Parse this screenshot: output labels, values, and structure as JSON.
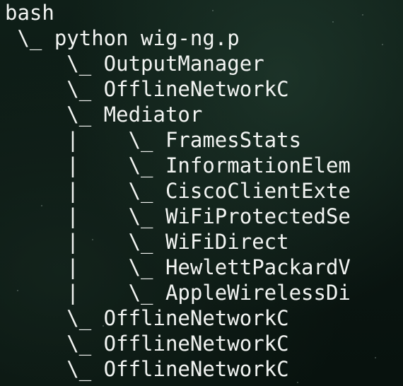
{
  "terminal": {
    "lines": [
      "bash",
      " \\_ python wig-ng.p",
      "     \\_ OutputManager",
      "     \\_ OfflineNetworkC",
      "     \\_ Mediator",
      "     |    \\_ FramesStats",
      "     |    \\_ InformationElem",
      "     |    \\_ CiscoClientExte",
      "     |    \\_ WiFiProtectedSe",
      "     |    \\_ WiFiDirect",
      "     |    \\_ HewlettPackardV",
      "     |    \\_ AppleWirelessDi",
      "     \\_ OfflineNetworkC",
      "     \\_ OfflineNetworkC",
      "     \\_ OfflineNetworkC"
    ]
  }
}
